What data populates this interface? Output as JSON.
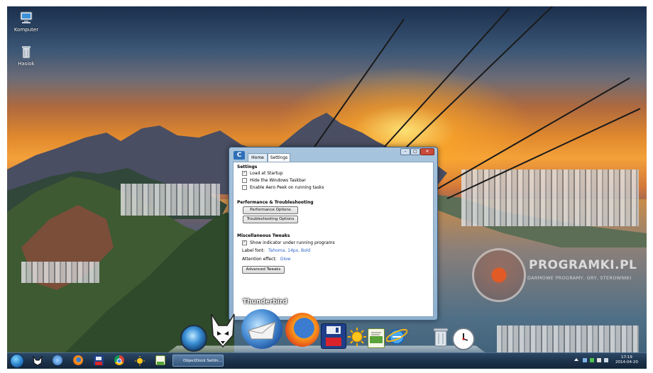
{
  "desktop": {
    "icons": [
      {
        "label": "Komputer",
        "icon": "computer-icon"
      },
      {
        "label": "Hasiok",
        "icon": "recycle-bin-icon"
      }
    ]
  },
  "window": {
    "logo_glyph": "C",
    "tabs": [
      {
        "label": "Home",
        "active": false
      },
      {
        "label": "Settings",
        "active": true
      }
    ],
    "controls": {
      "minimize": "–",
      "maximize": "□",
      "close": "✕"
    },
    "sections": {
      "settings": "Settings",
      "performance": "Performance & Troubleshooting",
      "misc": "Miscellaneous Tweaks"
    },
    "checkboxes": {
      "load_at_startup": {
        "label": "Load at Startup",
        "checked": true
      },
      "hide_taskbar": {
        "label": "Hide the Windows Taskbar",
        "checked": false
      },
      "aero_peek": {
        "label": "Enable Aero Peek on running tasks",
        "checked": false
      },
      "show_indicator": {
        "label": "Show indicator under running programs",
        "checked": true
      }
    },
    "buttons": {
      "performance_options": "Performance Options",
      "troubleshooting_options": "Troubleshooting Options",
      "advanced_tweaks": "Advanced Tweaks"
    },
    "label_font": {
      "label": "Label font:",
      "value": "Tahoma, 14px, Bold"
    },
    "attention_effect": {
      "label": "Attention effect:",
      "value": "Glow"
    }
  },
  "dock": {
    "hover_label": "Thunderbird",
    "items": [
      "windows-start-orb-icon",
      "foobar-fox-icon",
      "thunderbird-icon",
      "firefox-icon",
      "floppy-save-icon",
      "sun-icon",
      "notepad-icon",
      "internet-explorer-icon",
      "trash-can-icon",
      "clock-icon"
    ]
  },
  "watermark": {
    "title": "PROGRAMKI.PL",
    "subtitle": "DARMOWE PROGRAMY, GRY, STEROWNIKI"
  },
  "taskbar": {
    "pinned": [
      "windows-orb-icon",
      "foobar-icon",
      "thunderbird-icon",
      "firefox-icon",
      "save-icon",
      "chrome-icon",
      "sun-icon",
      "notepad-icon"
    ],
    "active_task": "ObjectDock Settin...",
    "clock": {
      "time": "17:19",
      "date": "2014-04-20"
    },
    "colors": {
      "bar": "#1a2f47",
      "accent": "#2a64c8"
    }
  }
}
